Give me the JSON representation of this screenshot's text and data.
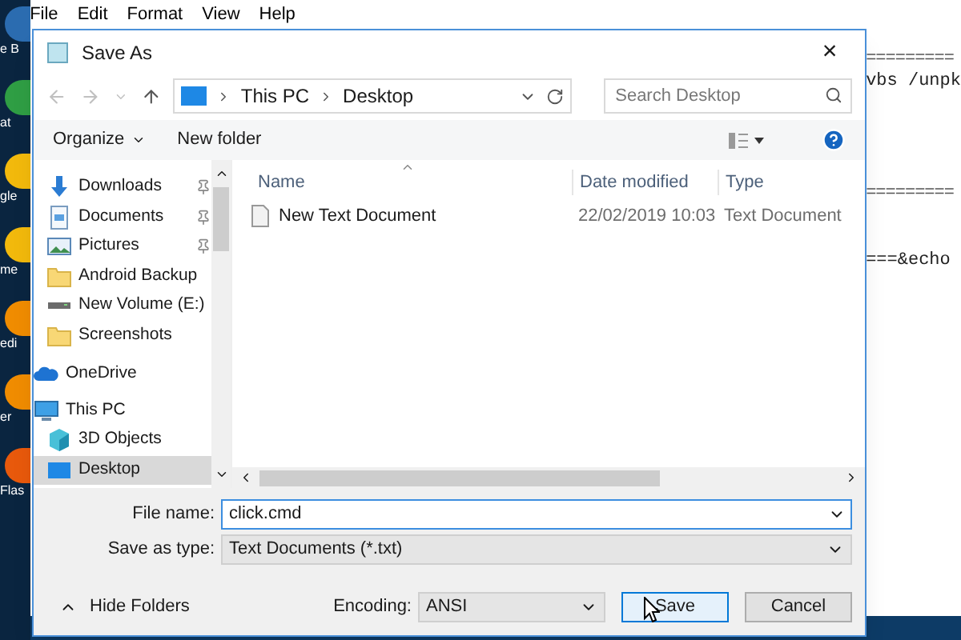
{
  "desktop_icons": [
    {
      "label": "e B",
      "color": "#2b6cb0"
    },
    {
      "label": "at",
      "color": "#2f9e44"
    },
    {
      "label": "gle",
      "color": "#f2b90c"
    },
    {
      "label": "me",
      "color": "#f2b90c"
    },
    {
      "label": "edi",
      "color": "#f08c00"
    },
    {
      "label": "er",
      "color": "#f08c00"
    },
    {
      "label": "Flas",
      "color": "#e8590c"
    }
  ],
  "notepad": {
    "menu": [
      "File",
      "Edit",
      "Format",
      "View",
      "Help"
    ],
    "lines": [
      {
        "kind": "rule",
        "text": "========="
      },
      {
        "kind": "text",
        "text": "vbs /unpk"
      },
      {
        "kind": "blank"
      },
      {
        "kind": "blank"
      },
      {
        "kind": "blank"
      },
      {
        "kind": "blank"
      },
      {
        "kind": "rule",
        "text": "========="
      },
      {
        "kind": "blank"
      },
      {
        "kind": "blank"
      },
      {
        "kind": "text",
        "text": "===&echo"
      }
    ]
  },
  "dialog": {
    "title": "Save As",
    "close": "×",
    "address": {
      "path": [
        "This PC",
        "Desktop"
      ],
      "search_placeholder": "Search Desktop"
    },
    "toolbar": {
      "organize": "Organize",
      "new_folder": "New folder"
    },
    "quick_access": [
      {
        "label": "Downloads",
        "kind": "download",
        "pinned": true,
        "selected": false
      },
      {
        "label": "Documents",
        "kind": "document",
        "pinned": true,
        "selected": false
      },
      {
        "label": "Pictures",
        "kind": "pictures",
        "pinned": true,
        "selected": false
      },
      {
        "label": "Android Backup",
        "kind": "folder",
        "pinned": false,
        "selected": false
      },
      {
        "label": "New Volume (E:)",
        "kind": "drive",
        "pinned": false,
        "selected": false
      },
      {
        "label": "Screenshots",
        "kind": "folder",
        "pinned": false,
        "selected": false
      }
    ],
    "nav_tree": [
      {
        "label": "OneDrive",
        "kind": "cloud",
        "selected": false
      },
      {
        "label": "This PC",
        "kind": "pc",
        "selected": false,
        "children": [
          {
            "label": "3D Objects",
            "kind": "cube",
            "selected": false
          },
          {
            "label": "Desktop",
            "kind": "desktop",
            "selected": true
          }
        ]
      }
    ],
    "columns": [
      "Name",
      "Date modified",
      "Type"
    ],
    "files": [
      {
        "name": "New Text Document",
        "date": "22/02/2019 10:03",
        "type": "Text Document"
      }
    ],
    "file_name": {
      "label": "File name:",
      "value": "click.cmd"
    },
    "save_type": {
      "label": "Save as type:",
      "value": "Text Documents (*.txt)"
    },
    "hide_folders": "Hide Folders",
    "encoding": {
      "label": "Encoding:",
      "value": "ANSI"
    },
    "buttons": [
      {
        "label": "Save",
        "selected": true
      },
      {
        "label": "Cancel",
        "selected": false
      }
    ]
  }
}
